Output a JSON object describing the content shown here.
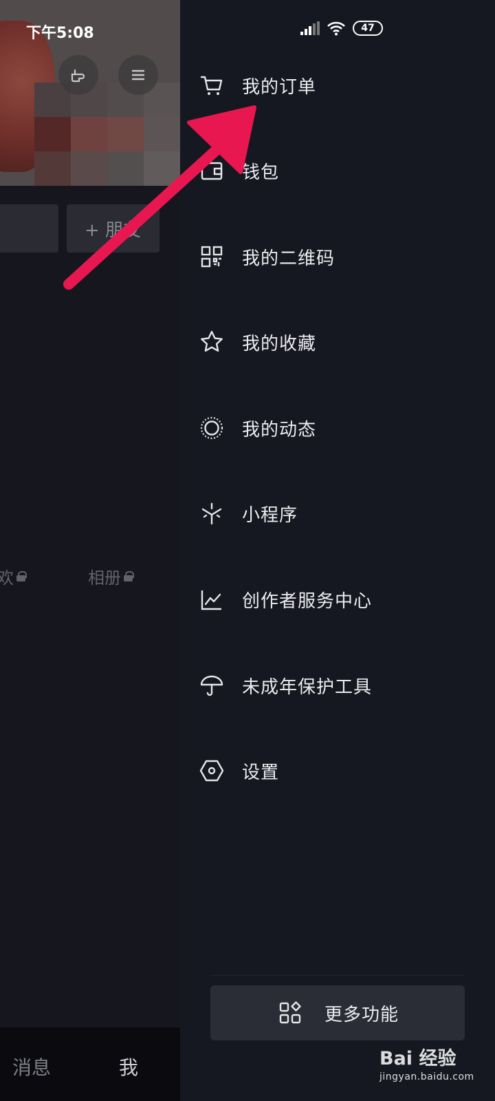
{
  "status_bar": {
    "time": "下午5:08",
    "battery": "47"
  },
  "left_page": {
    "friend_button": "+ 朋友",
    "tabs": [
      {
        "label": "欢"
      },
      {
        "label": "相册"
      }
    ],
    "bottom_nav": [
      {
        "label": "消息"
      },
      {
        "label": "我"
      }
    ]
  },
  "drawer": {
    "items": [
      {
        "label": "我的订单",
        "icon": "shopping-cart-icon"
      },
      {
        "label": "钱包",
        "icon": "wallet-icon"
      },
      {
        "label": "我的二维码",
        "icon": "qr-code-icon"
      },
      {
        "label": "我的收藏",
        "icon": "star-icon"
      },
      {
        "label": "我的动态",
        "icon": "moments-circle-icon"
      },
      {
        "label": "小程序",
        "icon": "mini-program-icon"
      },
      {
        "label": "创作者服务中心",
        "icon": "chart-line-icon"
      },
      {
        "label": "未成年保护工具",
        "icon": "umbrella-icon"
      },
      {
        "label": "设置",
        "icon": "hexagon-settings-icon"
      }
    ],
    "more_button": {
      "label": "更多功能",
      "icon": "grid-apps-icon"
    }
  },
  "watermark": {
    "brand": "Bai 经验",
    "url": "jingyan.baidu.com"
  },
  "colors": {
    "drawer_bg": "#161821",
    "arrow": "#e8174f",
    "text": "#ececf0"
  }
}
